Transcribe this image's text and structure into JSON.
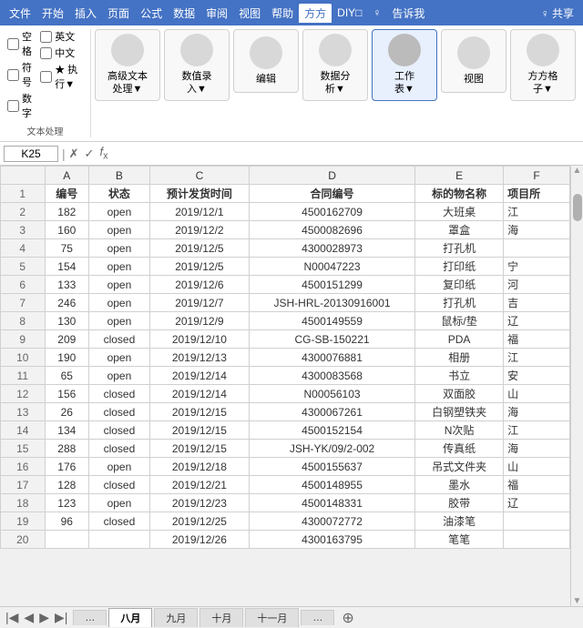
{
  "menubar": {
    "items": [
      "文件",
      "开始",
      "插入",
      "页面",
      "公式",
      "数据",
      "审阅",
      "视图",
      "帮助",
      "方方",
      "DIY□",
      "♀",
      "告诉我",
      "♀ 共享"
    ],
    "active": "方方"
  },
  "checkboxes": {
    "col1": [
      {
        "label": "空格",
        "checked": false
      },
      {
        "label": "符号",
        "checked": false
      },
      {
        "label": "数字",
        "checked": false
      }
    ],
    "col2": [
      {
        "label": "英文",
        "checked": false
      },
      {
        "label": "中文",
        "checked": false
      },
      {
        "label": "★ 执行▼",
        "checked": false
      }
    ],
    "section_label": "文本处理"
  },
  "ribbon_buttons": [
    {
      "label": "高级文本\n处理▼",
      "active": false
    },
    {
      "label": "数值录\n入▼",
      "active": false
    },
    {
      "label": "编辑",
      "active": false
    },
    {
      "label": "数据分\n析▼",
      "active": false
    },
    {
      "label": "工作\n表▼",
      "active": false
    },
    {
      "label": "视图",
      "active": false
    },
    {
      "label": "方方格\n子▼",
      "active": false
    }
  ],
  "formula_bar": {
    "cell_ref": "K25",
    "formula": ""
  },
  "column_headers": [
    "A",
    "B",
    "C",
    "D",
    "E",
    "F"
  ],
  "header_row": {
    "row_num": 1,
    "cols": [
      "编号",
      "状态",
      "预计发货时间",
      "合同编号",
      "标的物名称",
      "项目所"
    ]
  },
  "rows": [
    {
      "row_num": 2,
      "a": "182",
      "b": "open",
      "c": "2019/12/1",
      "d": "4500162709",
      "e": "大班桌",
      "f": "江"
    },
    {
      "row_num": 3,
      "a": "160",
      "b": "open",
      "c": "2019/12/2",
      "d": "4500082696",
      "e": "罩盒",
      "f": "海"
    },
    {
      "row_num": 4,
      "a": "75",
      "b": "open",
      "c": "2019/12/5",
      "d": "4300028973",
      "e": "打孔机",
      "f": ""
    },
    {
      "row_num": 5,
      "a": "154",
      "b": "open",
      "c": "2019/12/5",
      "d": "N00047223",
      "e": "打印纸",
      "f": "宁"
    },
    {
      "row_num": 6,
      "a": "133",
      "b": "open",
      "c": "2019/12/6",
      "d": "4500151299",
      "e": "复印纸",
      "f": "河"
    },
    {
      "row_num": 7,
      "a": "246",
      "b": "open",
      "c": "2019/12/7",
      "d": "JSH-HRL-20130916001",
      "e": "打孔机",
      "f": "吉"
    },
    {
      "row_num": 8,
      "a": "130",
      "b": "open",
      "c": "2019/12/9",
      "d": "4500149559",
      "e": "鼠标/垫",
      "f": "辽"
    },
    {
      "row_num": 9,
      "a": "209",
      "b": "closed",
      "c": "2019/12/10",
      "d": "CG-SB-150221",
      "e": "PDA",
      "f": "福"
    },
    {
      "row_num": 10,
      "a": "190",
      "b": "open",
      "c": "2019/12/13",
      "d": "4300076881",
      "e": "相册",
      "f": "江"
    },
    {
      "row_num": 11,
      "a": "65",
      "b": "open",
      "c": "2019/12/14",
      "d": "4300083568",
      "e": "书立",
      "f": "安"
    },
    {
      "row_num": 12,
      "a": "156",
      "b": "closed",
      "c": "2019/12/14",
      "d": "N00056103",
      "e": "双面胶",
      "f": "山"
    },
    {
      "row_num": 13,
      "a": "26",
      "b": "closed",
      "c": "2019/12/15",
      "d": "4300067261",
      "e": "白钢塑铁夹",
      "f": "海"
    },
    {
      "row_num": 14,
      "a": "134",
      "b": "closed",
      "c": "2019/12/15",
      "d": "4500152154",
      "e": "N次贴",
      "f": "江"
    },
    {
      "row_num": 15,
      "a": "288",
      "b": "closed",
      "c": "2019/12/15",
      "d": "JSH-YK/09/2-002",
      "e": "传真纸",
      "f": "海"
    },
    {
      "row_num": 16,
      "a": "176",
      "b": "open",
      "c": "2019/12/18",
      "d": "4500155637",
      "e": "吊式文件夹",
      "f": "山"
    },
    {
      "row_num": 17,
      "a": "128",
      "b": "closed",
      "c": "2019/12/21",
      "d": "4500148955",
      "e": "墨水",
      "f": "福"
    },
    {
      "row_num": 18,
      "a": "123",
      "b": "open",
      "c": "2019/12/23",
      "d": "4500148331",
      "e": "胶带",
      "f": "辽"
    },
    {
      "row_num": 19,
      "a": "96",
      "b": "closed",
      "c": "2019/12/25",
      "d": "4300072772",
      "e": "油漆笔",
      "f": ""
    },
    {
      "row_num": 20,
      "a": "",
      "b": "",
      "c": "2019/12/26",
      "d": "4300163795",
      "e": "笔笔",
      "f": ""
    }
  ],
  "sheet_tabs": [
    "八月",
    "九月",
    "十月",
    "十一月",
    "…"
  ],
  "active_tab": "八月"
}
